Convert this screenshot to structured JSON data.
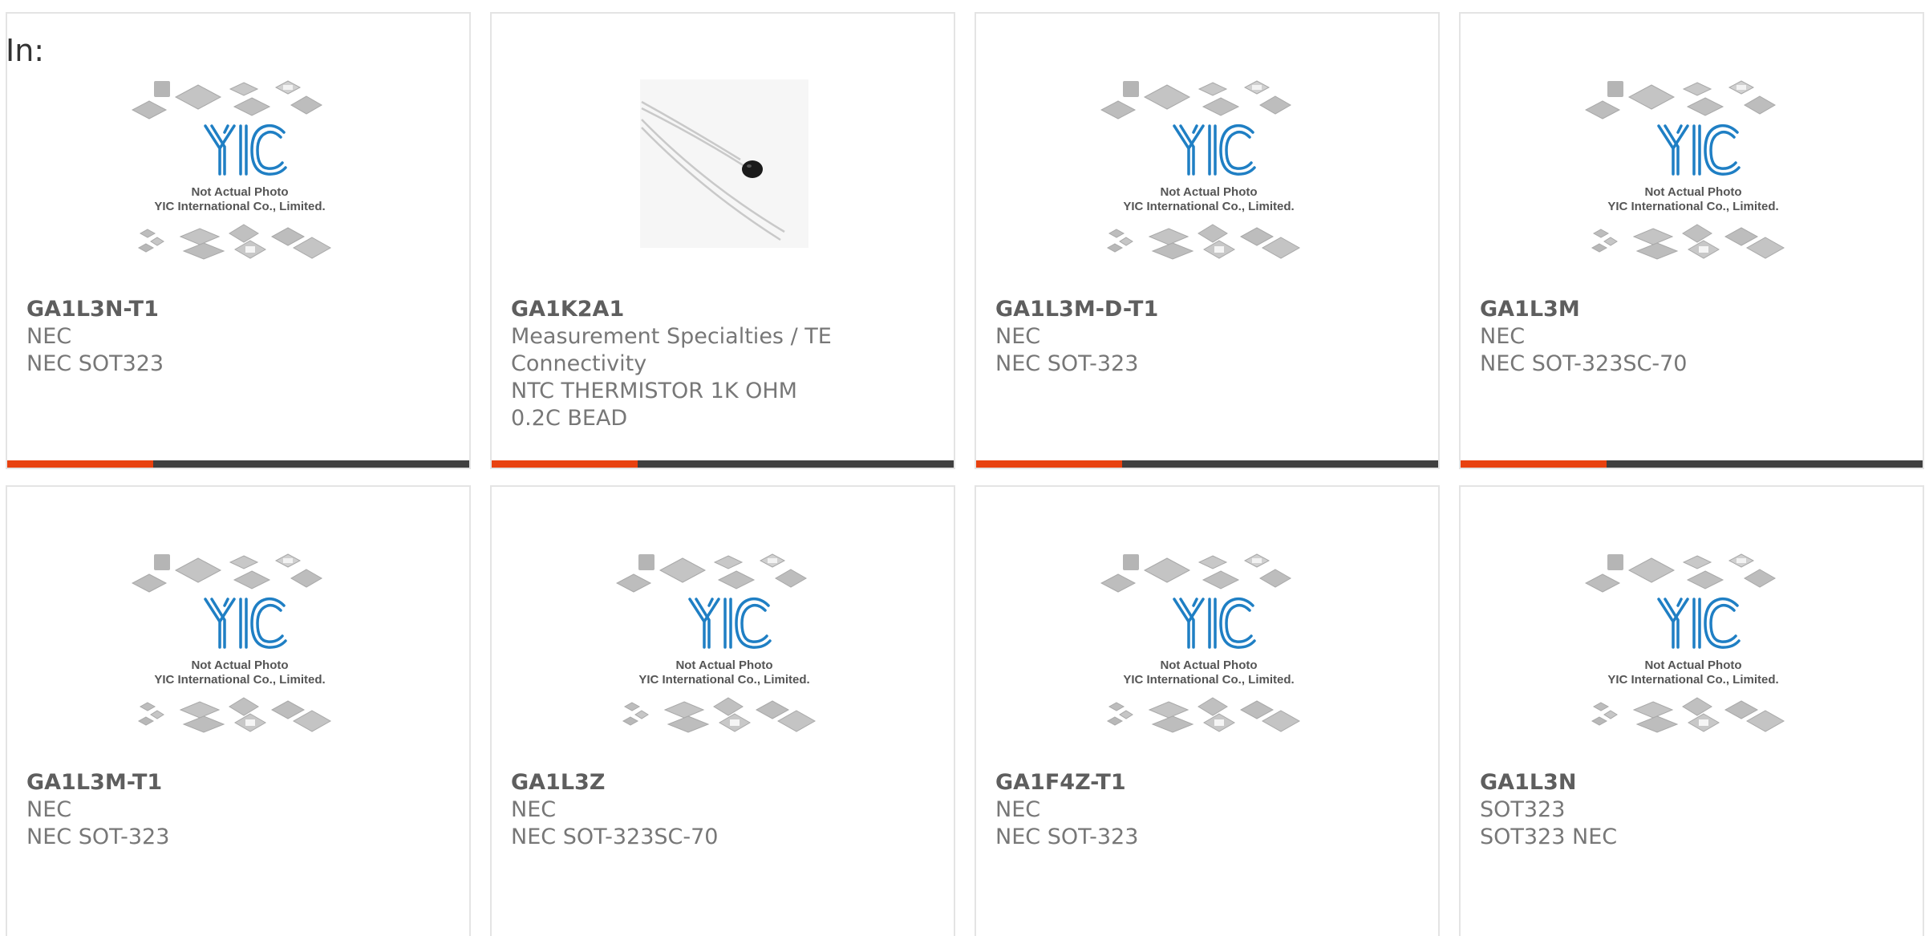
{
  "label_in": "In:",
  "colors": {
    "accent": "#e8410f",
    "bar": "#3f3f3f",
    "logo": "#1f7fc4"
  },
  "placeholder_image": {
    "icon": "yic-placeholder-icon",
    "caption_line1": "Not Actual Photo",
    "caption_line2": "YIC International Co., Limited."
  },
  "products": [
    {
      "part": "GA1L3N-T1",
      "mfr": "NEC",
      "desc": "NEC SOT323",
      "image": "yic-placeholder-icon"
    },
    {
      "part": "GA1K2A1",
      "mfr": "Measurement Specialties / TE Connectivity",
      "desc": "NTC THERMISTOR 1K OHM 0.2C BEAD",
      "image": "thermistor-photo-icon"
    },
    {
      "part": "GA1L3M-D-T1",
      "mfr": "NEC",
      "desc": "NEC SOT-323",
      "image": "yic-placeholder-icon"
    },
    {
      "part": "GA1L3M",
      "mfr": "NEC",
      "desc": "NEC SOT-323SC-70",
      "image": "yic-placeholder-icon"
    },
    {
      "part": "GA1L3M-T1",
      "mfr": "NEC",
      "desc": "NEC SOT-323",
      "image": "yic-placeholder-icon"
    },
    {
      "part": "GA1L3Z",
      "mfr": "NEC",
      "desc": "NEC SOT-323SC-70",
      "image": "yic-placeholder-icon"
    },
    {
      "part": "GA1F4Z-T1",
      "mfr": "NEC",
      "desc": "NEC SOT-323",
      "image": "yic-placeholder-icon"
    },
    {
      "part": "GA1L3N",
      "mfr": "SOT323",
      "desc": "SOT323 NEC",
      "image": "yic-placeholder-icon"
    }
  ]
}
